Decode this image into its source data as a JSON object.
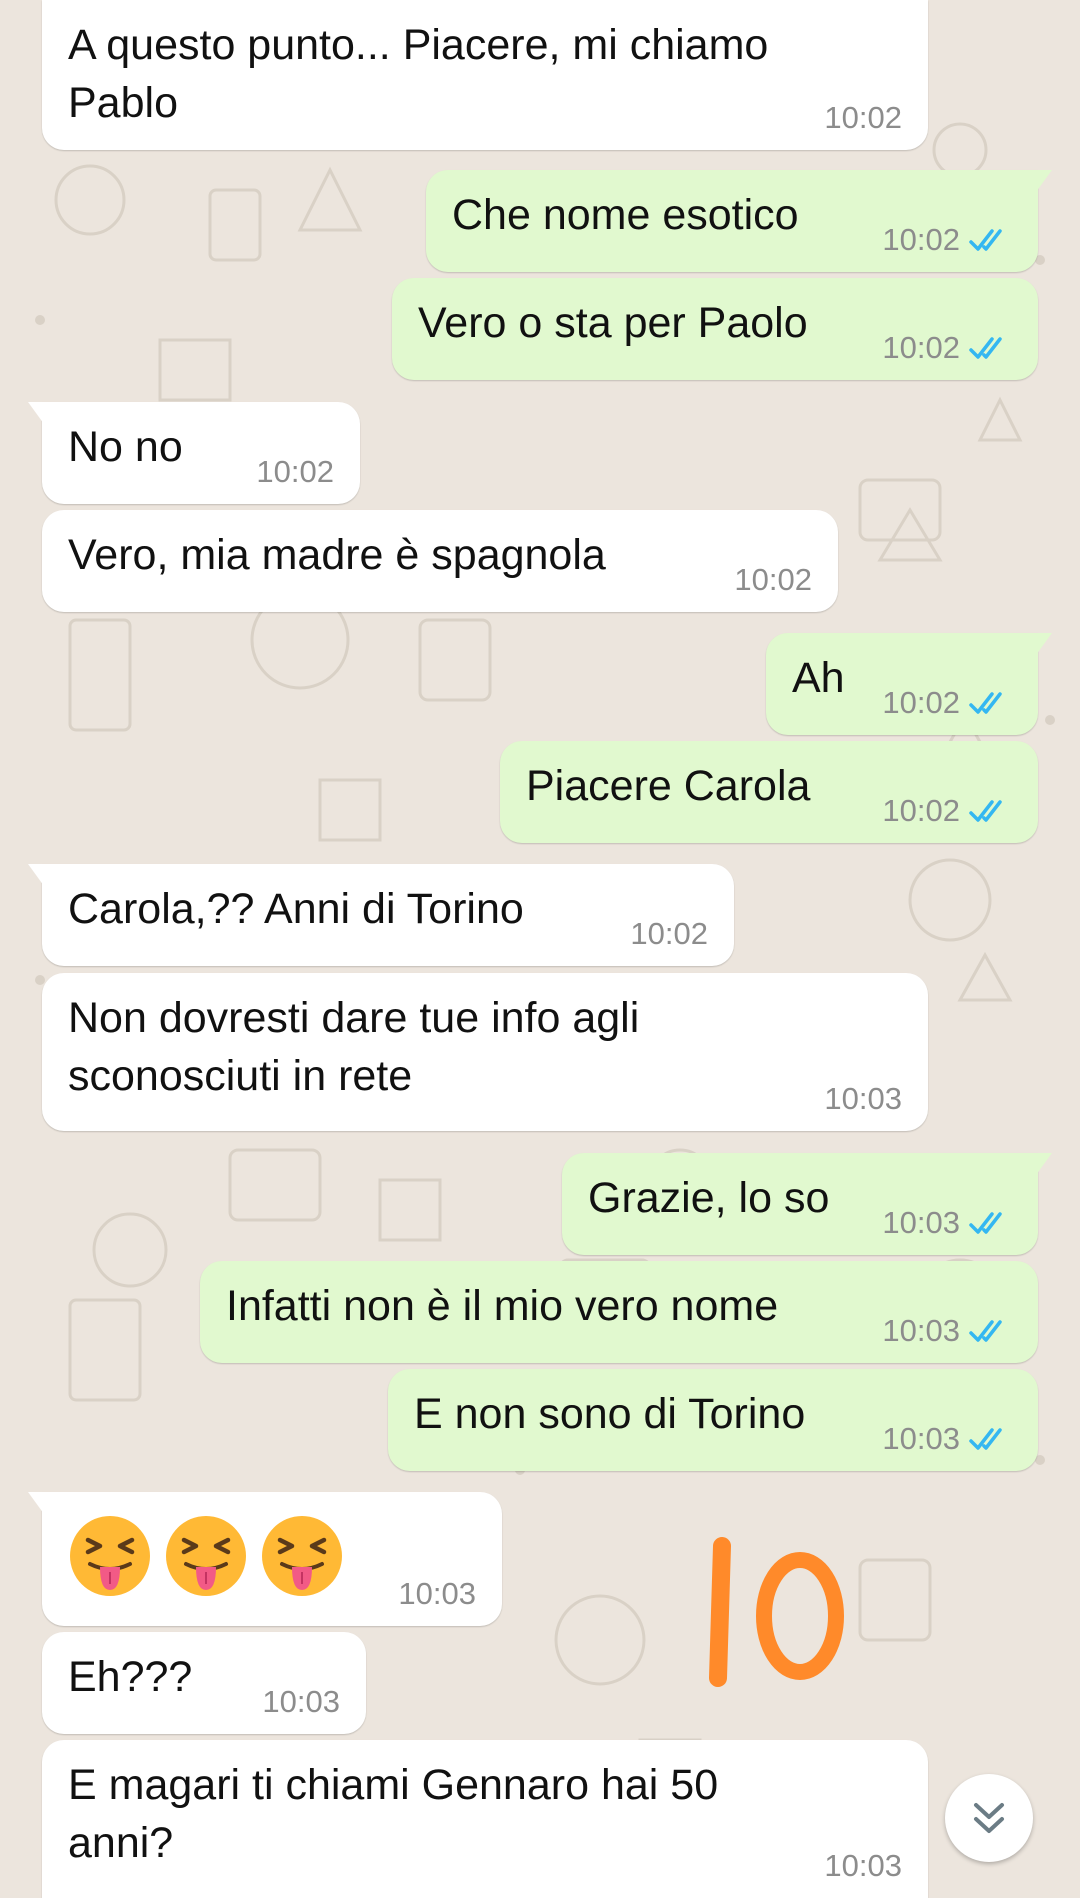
{
  "colors": {
    "wallpaper": "#ECE5DD",
    "incoming_bubble": "#FFFFFF",
    "outgoing_bubble": "#E1F9CF",
    "read_ticks": "#34B7F1",
    "annotation": "#FF8A2A"
  },
  "messages": [
    {
      "dir": "in",
      "text": "A questo punto... Piacere, mi chiamo\nPablo",
      "time": "10:02"
    },
    {
      "dir": "out",
      "text": "Che nome esotico",
      "time": "10:02",
      "status": "read"
    },
    {
      "dir": "out",
      "text": "Vero o sta per Paolo",
      "time": "10:02",
      "status": "read"
    },
    {
      "dir": "in",
      "text": "No no",
      "time": "10:02"
    },
    {
      "dir": "in",
      "text": "Vero, mia madre è spagnola",
      "time": "10:02"
    },
    {
      "dir": "out",
      "text": "Ah",
      "time": "10:02",
      "status": "read"
    },
    {
      "dir": "out",
      "text": "Piacere Carola",
      "time": "10:02",
      "status": "read"
    },
    {
      "dir": "in",
      "text": "Carola,?? Anni di Torino",
      "time": "10:02"
    },
    {
      "dir": "in",
      "text": "Non dovresti dare tue info agli\nsconosciuti in rete",
      "time": "10:03"
    },
    {
      "dir": "out",
      "text": "Grazie, lo so",
      "time": "10:03",
      "status": "read"
    },
    {
      "dir": "out",
      "text": "Infatti non è il mio vero nome",
      "time": "10:03",
      "status": "read"
    },
    {
      "dir": "out",
      "text": "E non sono di Torino",
      "time": "10:03",
      "status": "read"
    },
    {
      "dir": "in",
      "emoji": [
        "squinting-face-with-tongue",
        "squinting-face-with-tongue",
        "squinting-face-with-tongue"
      ],
      "time": "10:03"
    },
    {
      "dir": "in",
      "text": "Eh???",
      "time": "10:03"
    },
    {
      "dir": "in",
      "text": "E magari ti chiami Gennaro hai 50\nanni?",
      "time": "10:03"
    }
  ],
  "annotation": {
    "text": "10"
  },
  "scroll_button": {
    "icon": "double-chevron-down-icon"
  }
}
